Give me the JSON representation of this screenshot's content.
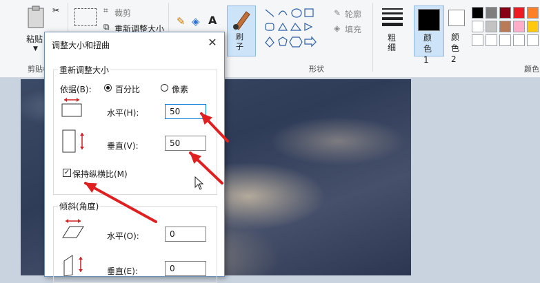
{
  "ribbon": {
    "crop_label": "裁剪",
    "resize_label": "重新调整大小",
    "paste_label": "粘贴",
    "clipboard_group": "剪贴板",
    "brush_label": "刷子",
    "outline_label": "轮廓",
    "fill_label": "填充",
    "shapes_group": "形状",
    "size_label": "粗细",
    "color1_label": "颜色 1",
    "color2_label": "颜色 2",
    "colors_group": "颜色",
    "palette": [
      "#000000",
      "#7f7f7f",
      "#880015",
      "#ed1c24",
      "#ff7f27",
      "#fff200",
      "#ffffff",
      "#c3c3c3",
      "#b97a57",
      "#ffaec9",
      "#ffc90e",
      "#efe4b0"
    ]
  },
  "dialog": {
    "title": "调整大小和扭曲",
    "close_icon": "close-icon",
    "resize_section": "重新调整大小",
    "by_label": "依据(B):",
    "percent_label": "百分比",
    "pixels_label": "像素",
    "horizontal_label": "水平(H):",
    "horizontal_value": "50",
    "vertical_label": "垂直(V):",
    "vertical_value": "50",
    "keep_ratio_label": "保持纵横比(M)",
    "skew_section": "倾斜(角度)",
    "skew_h_label": "水平(O):",
    "skew_h_value": "0",
    "skew_v_label": "垂直(E):",
    "skew_v_value": "0"
  },
  "annotations": {
    "arrow_color": "#e02020"
  }
}
